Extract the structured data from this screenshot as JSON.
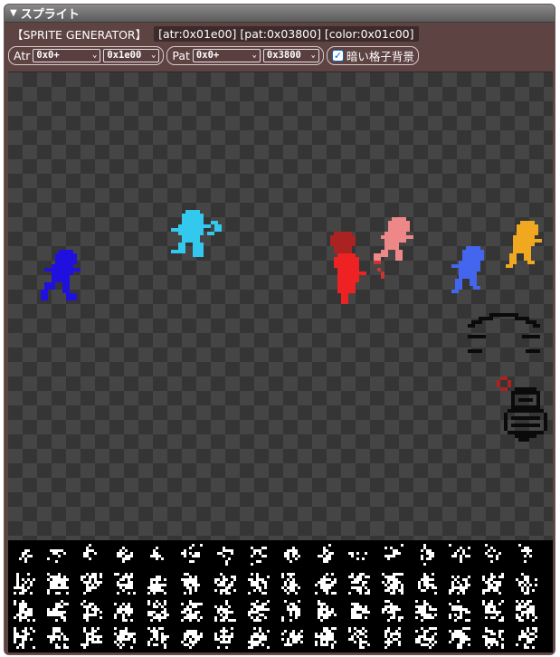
{
  "panel": {
    "title": "スプライト",
    "arrow": "▼"
  },
  "info": {
    "label": "【SPRITE GENERATOR】",
    "addresses": "[atr:0x01e00] [pat:0x03800] [color:0x01c00]"
  },
  "controls": {
    "atr": {
      "label": "Atr",
      "offset": "0x0+",
      "base": "0x1e00"
    },
    "pat": {
      "label": "Pat",
      "offset": "0x0+",
      "base": "0x3800"
    },
    "dark_grid": {
      "label": "暗い格子背景",
      "checked": true
    }
  },
  "colors": {
    "blue": "#2010e0",
    "cyan": "#33c8ee",
    "red": "#ee2222",
    "dark_red": "#aa2222",
    "pink": "#ee8888",
    "light_blue": "#4466ee",
    "orange": "#f0a820",
    "black": "#0a0a0a"
  }
}
